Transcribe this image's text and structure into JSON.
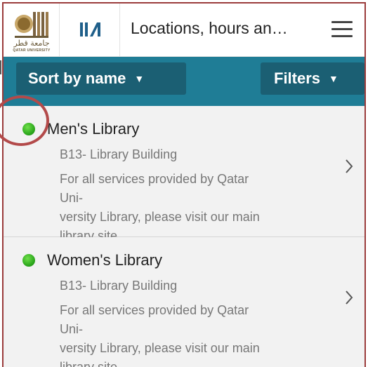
{
  "header": {
    "logo_arabic": "جامعة قطر",
    "logo_english": "QATAR UNIVERSITY",
    "library_icon": "library-books-icon",
    "title": "Locations, hours an…",
    "menu_icon": "hamburger-menu-icon"
  },
  "toolbar": {
    "sort_label": "Sort by name",
    "filter_label": "Filters",
    "caret": "▼"
  },
  "locations": [
    {
      "name": "Men's Library",
      "building": "B13- Library Building",
      "description_lines": [
        "For all services provided by Qatar Uni-",
        "versity Library, please visit our main",
        "library site."
      ],
      "status_color": "#2aa51b"
    },
    {
      "name": "Women's Library",
      "building": "B13- Library Building",
      "description_lines": [
        "For all services provided by Qatar Uni-",
        "versity Library, please visit our main",
        "library site."
      ],
      "status_color": "#2aa51b"
    }
  ],
  "colors": {
    "toolbar": "#1f7d96",
    "toolbar_button": "#1b5f73",
    "highlight": "#b34a4a",
    "frame": "#9a3b3b"
  }
}
